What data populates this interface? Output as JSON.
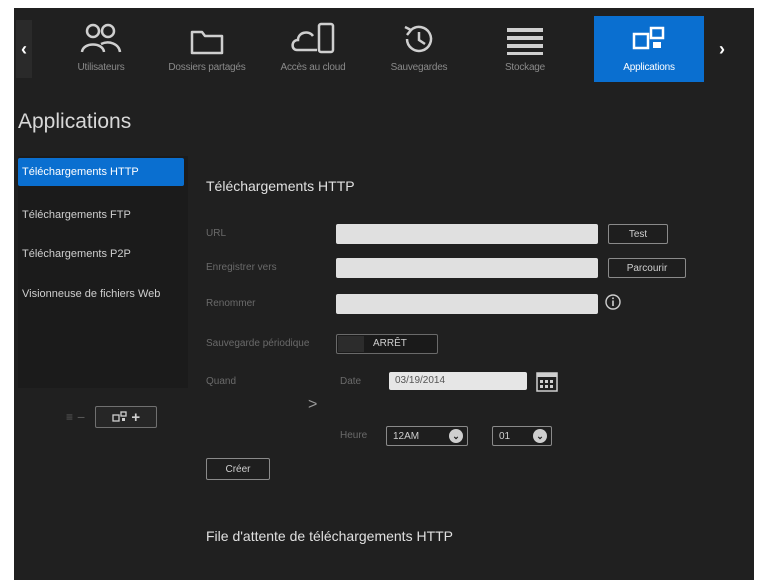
{
  "nav": {
    "items": [
      {
        "label": "Utilisateurs",
        "icon": "users-icon"
      },
      {
        "label": "Dossiers partagés",
        "icon": "folder-icon"
      },
      {
        "label": "Accès au cloud",
        "icon": "cloud-access-icon"
      },
      {
        "label": "Sauvegardes",
        "icon": "backup-history-icon"
      },
      {
        "label": "Stockage",
        "icon": "storage-icon"
      },
      {
        "label": "Applications",
        "icon": "applications-icon"
      }
    ],
    "active_index": 5,
    "prev_glyph": "‹",
    "next_glyph": "›"
  },
  "page": {
    "title": "Applications"
  },
  "sidebar": {
    "items": [
      {
        "label": "Téléchargements HTTP",
        "active": true
      },
      {
        "label": "Téléchargements FTP",
        "active": false
      },
      {
        "label": "Téléchargements P2P",
        "active": false
      },
      {
        "label": "Visionneuse de fichiers Web",
        "active": false
      }
    ],
    "remove_label": "−",
    "add_label": "+"
  },
  "form": {
    "section_title": "Téléchargements HTTP",
    "url_label": "URL",
    "url_value": "",
    "test_label": "Test",
    "save_to_label": "Enregistrer vers",
    "save_to_value": "",
    "browse_label": "Parcourir",
    "rename_label": "Renommer",
    "rename_value": "",
    "recurring_label": "Sauvegarde périodique",
    "recurring_state": "ARRÊT",
    "when_label": "Quand",
    "date_label": "Date",
    "date_value": "03/19/2014",
    "hour_label": "Heure",
    "hour_value": "12AM",
    "minute_value": "01",
    "create_label": "Créer",
    "chevron": ">"
  },
  "queue": {
    "title": "File d'attente de téléchargements HTTP"
  },
  "colors": {
    "accent": "#0a6fd0",
    "background": "#202020"
  }
}
